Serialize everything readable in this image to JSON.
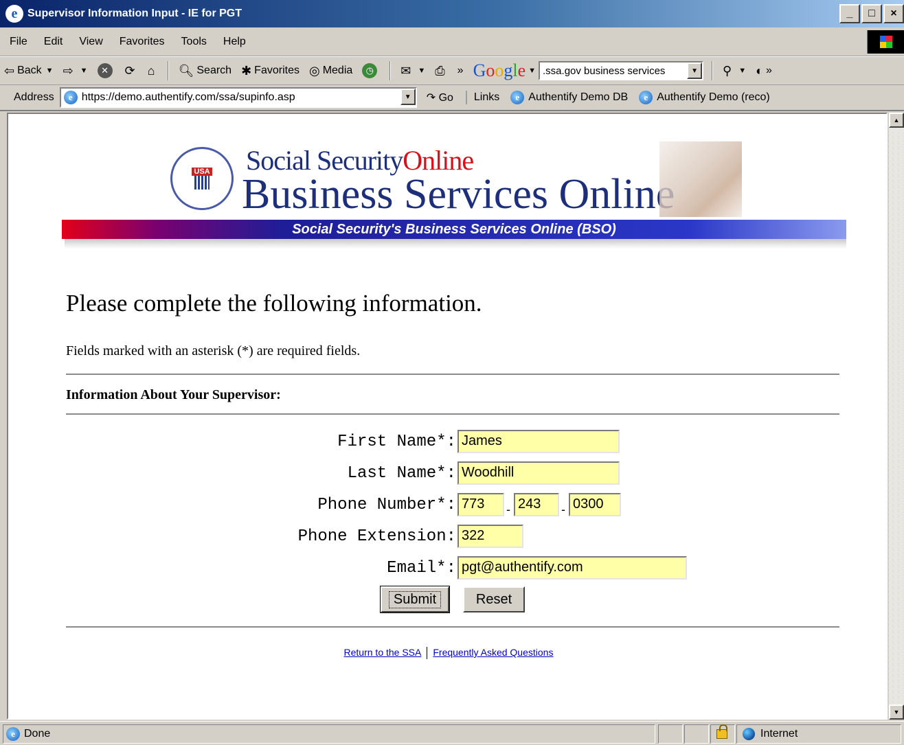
{
  "window": {
    "title": "Supervisor Information Input - IE for PGT",
    "controls": [
      "_",
      "□",
      "×"
    ]
  },
  "menu": [
    "File",
    "Edit",
    "View",
    "Favorites",
    "Tools",
    "Help"
  ],
  "toolbar": {
    "back": "Back",
    "search": "Search",
    "favorites": "Favorites",
    "media": "Media",
    "google_search_value": ".ssa.gov business services"
  },
  "address": {
    "label": "Address",
    "url": "https://demo.authentify.com/ssa/supinfo.asp",
    "go": "Go",
    "links_label": "Links",
    "links": [
      "Authentify Demo DB",
      "Authentify Demo (reco)"
    ]
  },
  "banner": {
    "line1_a": "Social Security",
    "line1_b": "Online",
    "line2": "Business Services Online",
    "strip": "Social Security's Business Services Online (BSO)",
    "seal_text": "USA"
  },
  "page": {
    "heading": "Please complete the following information.",
    "note": "Fields marked with an asterisk (*) are required fields.",
    "section_title": "Information About Your Supervisor:"
  },
  "form": {
    "first_name_label": "First Name*:",
    "first_name": "James",
    "last_name_label": "Last Name*:",
    "last_name": "Woodhill",
    "phone_label": "Phone Number*:",
    "phone_area": "773",
    "phone_prefix": "243",
    "phone_line": "0300",
    "phone_sep": "-",
    "extension_label": "Phone Extension:",
    "extension": "322",
    "email_label": "Email*:",
    "email": "pgt@authentify.com",
    "submit": "Submit",
    "reset": "Reset"
  },
  "footer": {
    "link1": "Return to the SSA",
    "link2": "Frequently Asked Questions"
  },
  "status": {
    "text": "Done",
    "zone": "Internet"
  }
}
